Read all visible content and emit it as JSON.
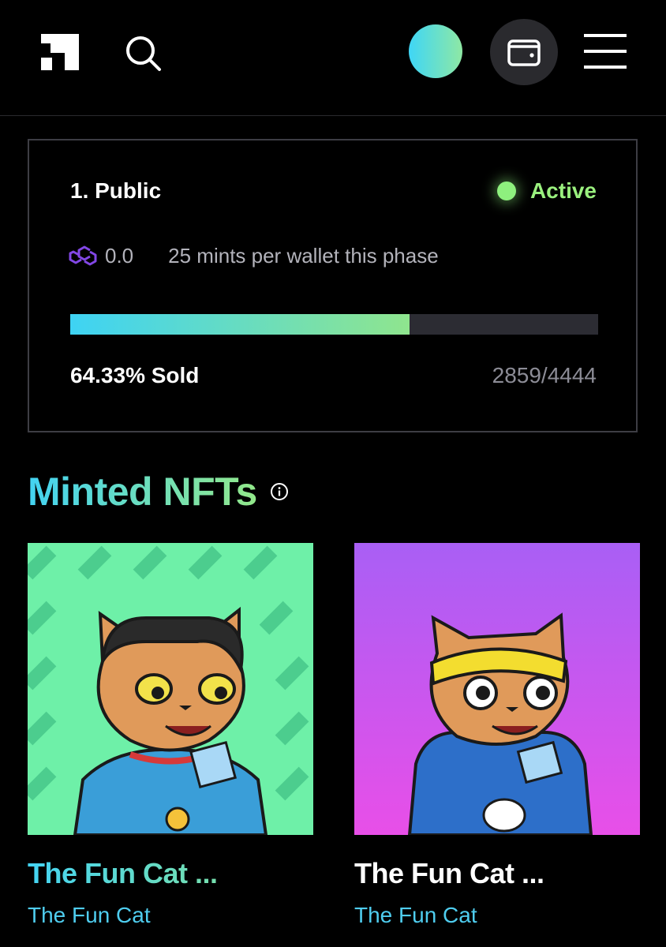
{
  "header": {
    "logo_icon": "brand-logo-icon",
    "search_icon": "search-icon",
    "wallet_icon": "wallet-icon",
    "menu_icon": "hamburger-menu-icon"
  },
  "phase": {
    "title": "1. Public",
    "status": "Active",
    "currency_icon": "polygon-icon",
    "price": "0.0",
    "limit": "25 mints per wallet this phase",
    "sold_label": "64.33% Sold",
    "sold_fraction": 0.6433,
    "count": "2859/4444",
    "colors": {
      "status": "#9af07e",
      "bar_start": "#3ed3f4",
      "bar_end": "#8fe58e"
    }
  },
  "section": {
    "title": "Minted NFTs",
    "info_icon": "info-icon"
  },
  "nfts": [
    {
      "name": "The Fun Cat ...",
      "collection": "The Fun Cat",
      "bg": "#6ef0a8"
    },
    {
      "name": "The Fun Cat ...",
      "collection": "The Fun Cat",
      "bg": "#b260f0"
    }
  ]
}
